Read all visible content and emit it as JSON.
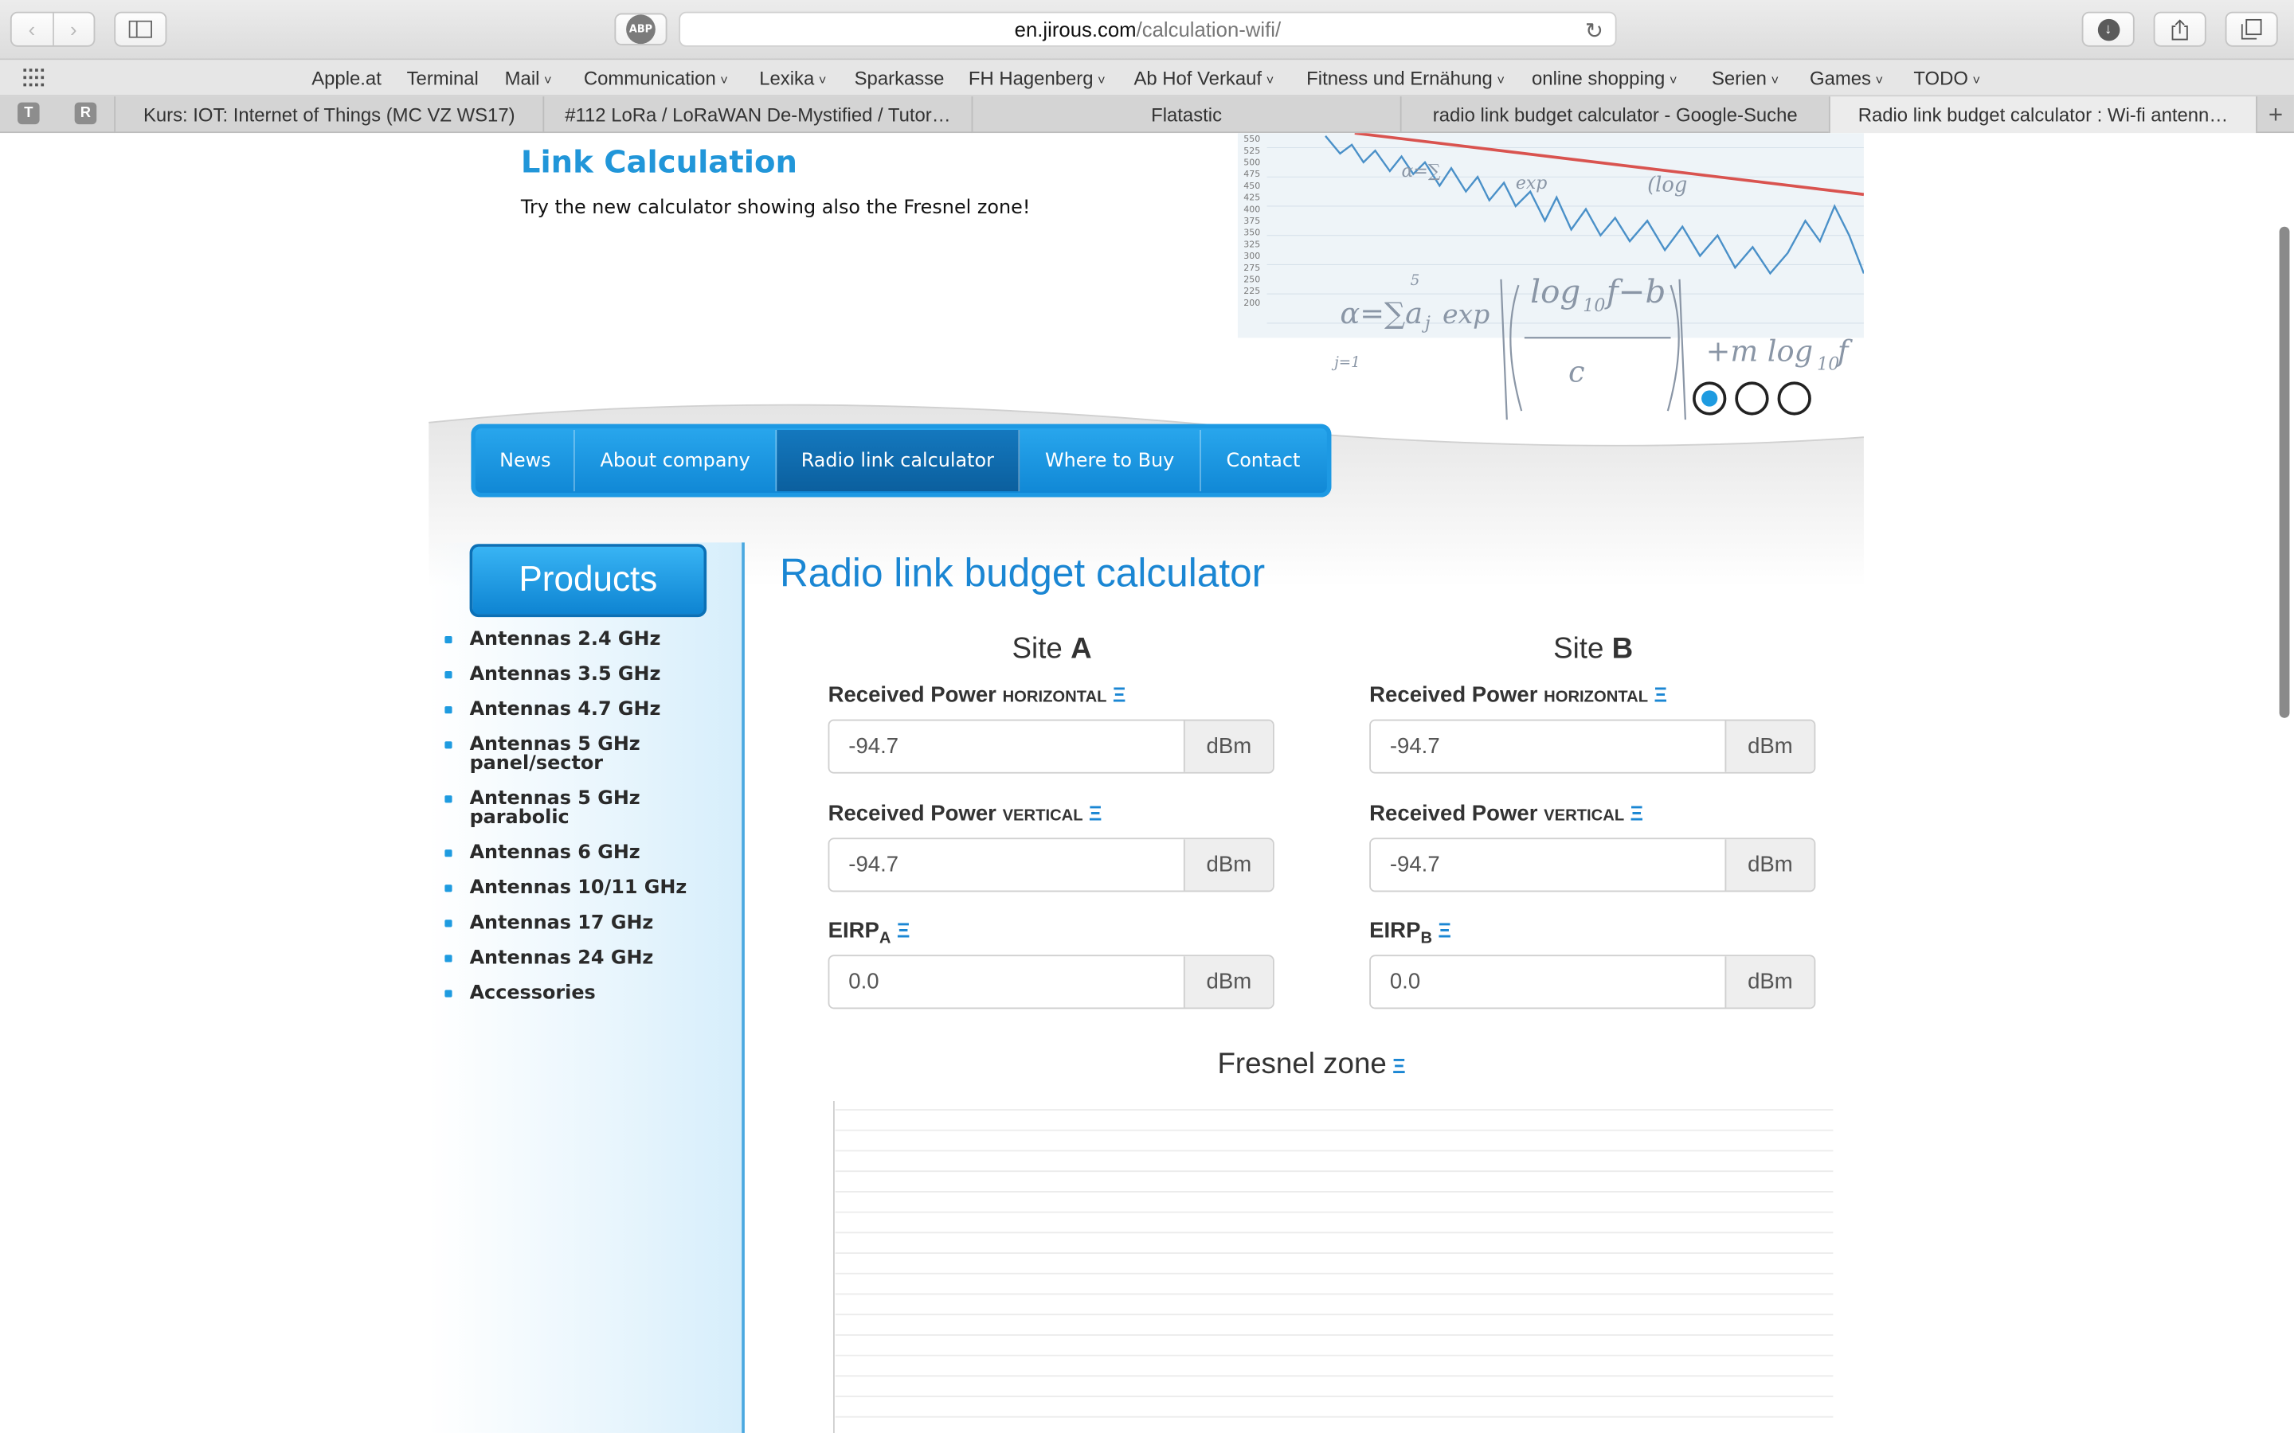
{
  "browser": {
    "url_domain": "en.jirous.com",
    "url_path": "/calculation-wifi/",
    "abp_label": "ABP"
  },
  "bookmarks": [
    "Apple.at",
    "Terminal",
    "Mail",
    "Communication",
    "Lexika",
    "Sparkasse",
    "FH Hagenberg",
    "Ab Hof Verkauf",
    "Fitness und Ernähung",
    "online shopping",
    "Serien",
    "Games",
    "TODO"
  ],
  "tabs": {
    "pinned": [
      "T",
      "R"
    ],
    "items": [
      "Kurs: IOT: Internet of Things (MC VZ WS17)",
      "#112 LoRa / LoRaWAN De-Mystified / Tutor…",
      "Flatastic",
      "radio link budget calculator - Google-Suche",
      "Radio link budget calculator : Wi-fi antenn…"
    ]
  },
  "hero": {
    "title": "Link Calculation",
    "text": "Try the new calculator showing also the Fresnel zone!"
  },
  "nav": {
    "items": [
      "News",
      "About company",
      "Radio link calculator",
      "Where to Buy",
      "Contact"
    ],
    "active": "Radio link calculator"
  },
  "sidebar": {
    "products_label": "Products",
    "items": [
      "Antennas 2.4 GHz",
      "Antennas 3.5 GHz",
      "Antennas 4.7 GHz",
      "Antennas 5 GHz panel/sector",
      "Antennas 5 GHz parabolic",
      "Antennas 6 GHz",
      "Antennas 10/11 GHz",
      "Antennas 17 GHz",
      "Antennas 24 GHz",
      "Accessories"
    ]
  },
  "calculator": {
    "title": "Radio link budget calculator",
    "info_glyph": "Ξ",
    "unit": "dBm",
    "site_word": "Site",
    "site_a": {
      "letter": "A",
      "rx_h_label": "Received Power",
      "rx_h_sub": "HORIZONTAL",
      "rx_h_value": "-94.7",
      "rx_v_label": "Received Power",
      "rx_v_sub": "VERTICAL",
      "rx_v_value": "-94.7",
      "eirp_label": "EIRP",
      "eirp_sub": "A",
      "eirp_value": "0.0"
    },
    "site_b": {
      "letter": "B",
      "rx_h_label": "Received Power",
      "rx_h_sub": "HORIZONTAL",
      "rx_h_value": "-94.7",
      "rx_v_label": "Received Power",
      "rx_v_sub": "VERTICAL",
      "rx_v_value": "-94.7",
      "eirp_label": "EIRP",
      "eirp_sub": "B",
      "eirp_value": "0.0"
    },
    "fresnel_title": "Fresnel zone"
  },
  "colors": {
    "accent": "#1a86d3",
    "nav_blue": "#1e9be0",
    "nav_active": "#0b5f9e"
  }
}
